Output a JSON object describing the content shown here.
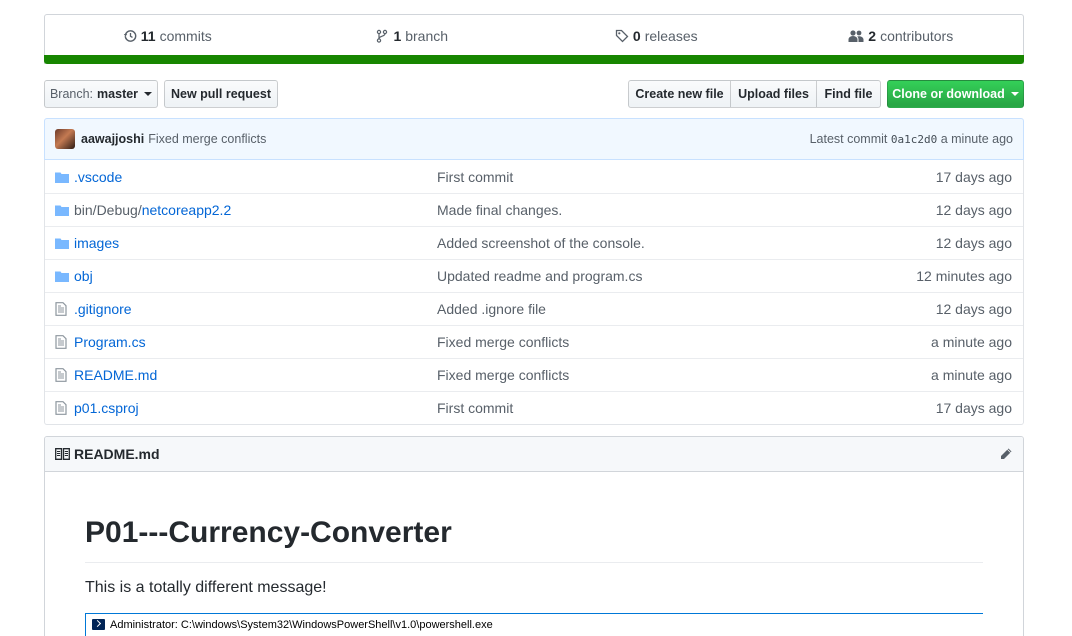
{
  "summary": {
    "commits": {
      "count": "11",
      "label": "commits"
    },
    "branches": {
      "count": "1",
      "label": "branch"
    },
    "releases": {
      "count": "0",
      "label": "releases"
    },
    "contributors": {
      "count": "2",
      "label": "contributors"
    },
    "language_color": "#178600"
  },
  "toolbar": {
    "branch_prefix": "Branch:",
    "branch_name": "master",
    "new_pull_request": "New pull request",
    "create_new_file": "Create new file",
    "upload_files": "Upload files",
    "find_file": "Find file",
    "clone_or_download": "Clone or download"
  },
  "latest_commit": {
    "author": "aawajjoshi",
    "message": "Fixed merge conflicts",
    "prefix": "Latest commit",
    "sha": "0a1c2d0",
    "age": "a minute ago"
  },
  "files": [
    {
      "type": "folder",
      "name": ".vscode",
      "name_prefix": "",
      "message": "First commit",
      "age": "17 days ago"
    },
    {
      "type": "folder",
      "name": "netcoreapp2.2",
      "name_prefix": "bin/Debug/",
      "message": "Made final changes.",
      "age": "12 days ago"
    },
    {
      "type": "folder",
      "name": "images",
      "name_prefix": "",
      "message": "Added screenshot of the console.",
      "age": "12 days ago"
    },
    {
      "type": "folder",
      "name": "obj",
      "name_prefix": "",
      "message": "Updated readme and program.cs",
      "age": "12 minutes ago"
    },
    {
      "type": "file",
      "name": ".gitignore",
      "name_prefix": "",
      "message": "Added .ignore file",
      "age": "12 days ago"
    },
    {
      "type": "file",
      "name": "Program.cs",
      "name_prefix": "",
      "message": "Fixed merge conflicts",
      "age": "a minute ago"
    },
    {
      "type": "file",
      "name": "README.md",
      "name_prefix": "",
      "message": "Fixed merge conflicts",
      "age": "a minute ago"
    },
    {
      "type": "file",
      "name": "p01.csproj",
      "name_prefix": "",
      "message": "First commit",
      "age": "17 days ago"
    }
  ],
  "readme": {
    "filename": "README.md",
    "heading": "P01---Currency-Converter",
    "paragraph": "This is a totally different message!",
    "image_window_title": "Administrator: C:\\windows\\System32\\WindowsPowerShell\\v1.0\\powershell.exe"
  }
}
